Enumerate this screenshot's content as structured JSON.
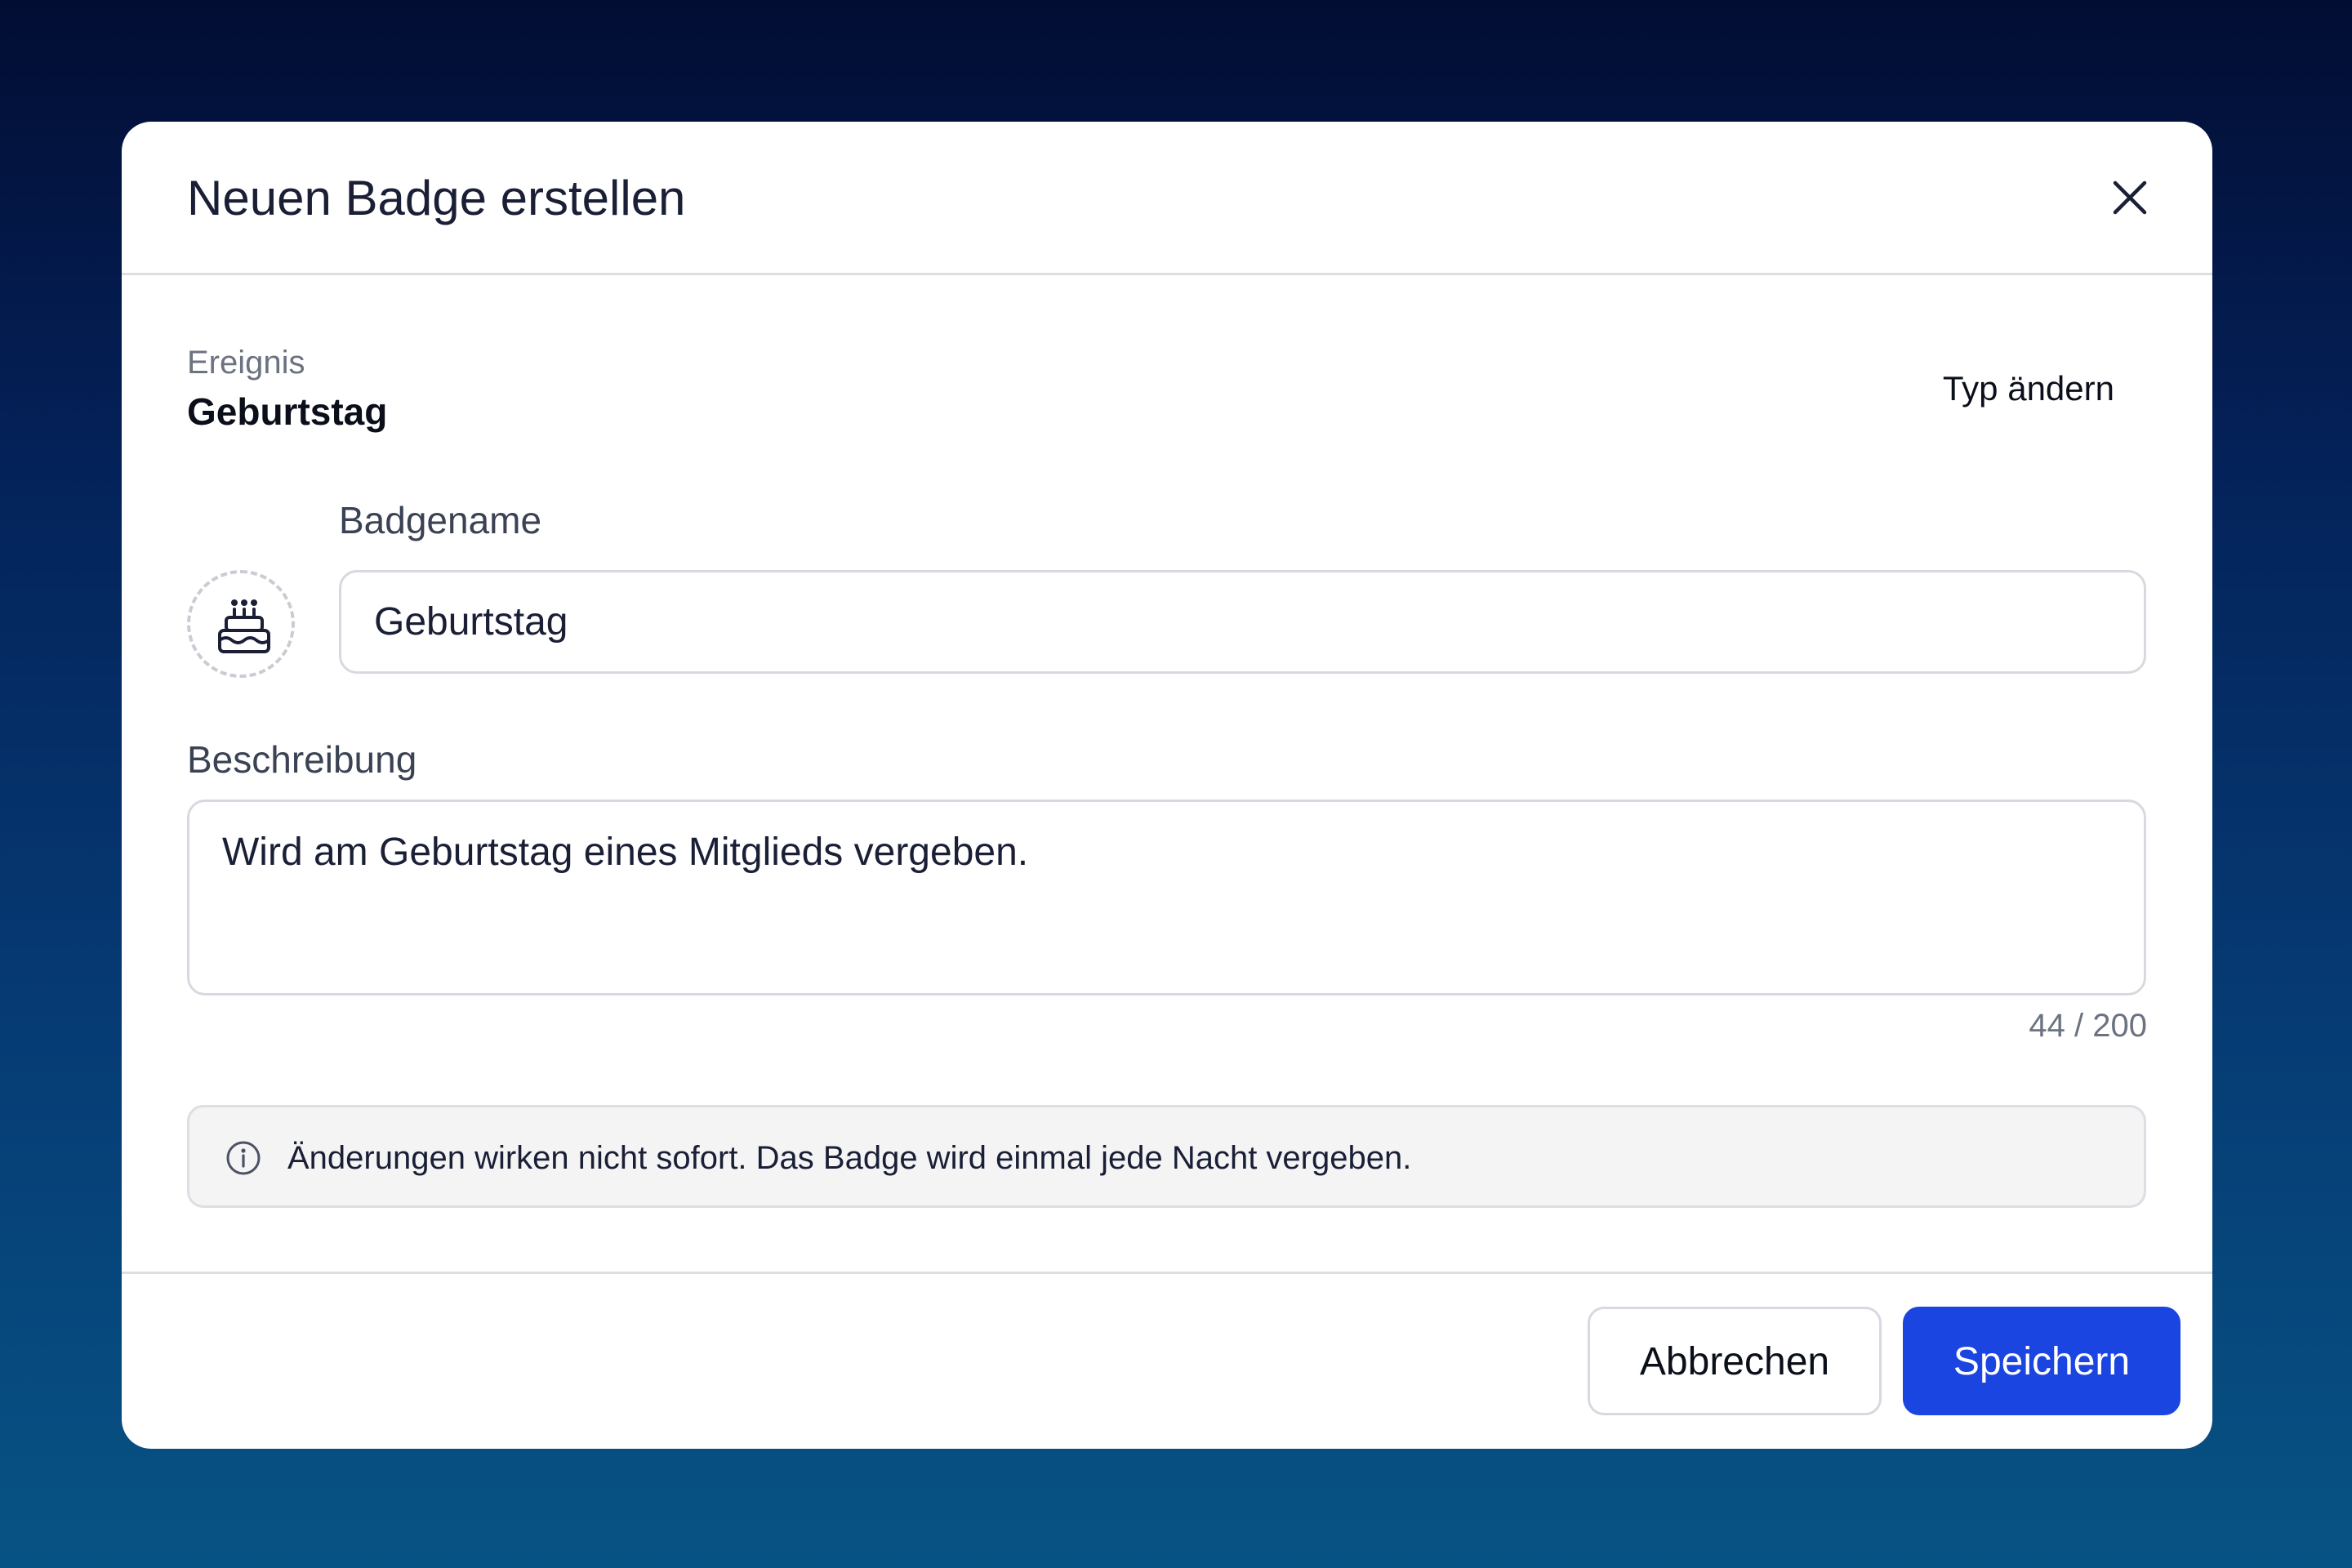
{
  "modal": {
    "title": "Neuen Badge erstellen"
  },
  "event": {
    "label": "Ereignis",
    "value": "Geburtstag",
    "change_type_label": "Typ ändern"
  },
  "badge": {
    "icon": "cake-icon"
  },
  "badgename": {
    "label": "Badgename",
    "value": "Geburtstag"
  },
  "description": {
    "label": "Beschreibung",
    "value": "Wird am Geburtstag eines Mitglieds vergeben.",
    "counter": "44 / 200"
  },
  "info": {
    "icon": "info-icon",
    "text": "Änderungen wirken nicht sofort. Das Badge wird einmal jede Nacht vergeben."
  },
  "footer": {
    "cancel_label": "Abbrechen",
    "save_label": "Speichern"
  },
  "colors": {
    "primary": "#1a45e0",
    "background_top": "#020d33",
    "background_bottom": "#075384"
  }
}
